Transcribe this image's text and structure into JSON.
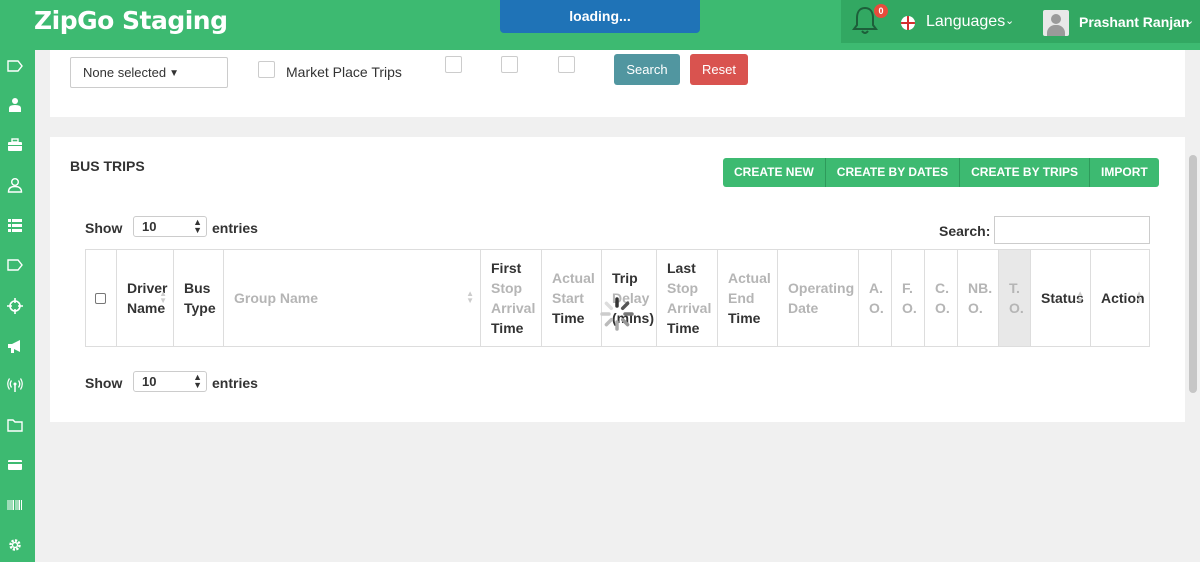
{
  "header": {
    "brand": "ZipGo Staging",
    "loading_text": "loading...",
    "notifications_count": "0",
    "languages_label": "Languages",
    "user_name": "Prashant Ranjan",
    "icons": [
      "bell-icon",
      "england-flag-icon",
      "chevron-down-icon",
      "user-avatar",
      "chevron-down-icon"
    ]
  },
  "sidebar": {
    "icons": [
      "tag-icon",
      "driver-icon",
      "briefcase-icon",
      "user-icon",
      "list-icon",
      "tag-icon",
      "crosshair-icon",
      "megaphone-icon",
      "antenna-icon",
      "folder-icon",
      "credit-card-icon",
      "barcode-icon",
      "gear-icon"
    ]
  },
  "filters": {
    "multiselect_value": "None selected",
    "market_place_label": "Market Place Trips",
    "search_button": "Search",
    "reset_button": "Reset"
  },
  "bus_trips": {
    "title": "BUS TRIPS",
    "actions": [
      "CREATE NEW",
      "CREATE BY DATES",
      "CREATE BY TRIPS",
      "IMPORT"
    ],
    "show_label": "Show",
    "entries_value": "10",
    "entries_label": "entries",
    "search_label": "Search:",
    "search_value": "",
    "columns": [
      {
        "line1": "",
        "line2": "",
        "line3": "",
        "line4": ""
      },
      {
        "line1": "Driver",
        "line2": "Name",
        "line3": "",
        "line4": ""
      },
      {
        "line1": "Bus",
        "line2": "Type",
        "line3": "",
        "line4": ""
      },
      {
        "line1": "Group Name",
        "line2": "",
        "line3": "",
        "line4": ""
      },
      {
        "line1": "First",
        "line2": "Stop",
        "line3": "Arrival",
        "line4": "Time"
      },
      {
        "line1": "Actual",
        "line2": "Start",
        "line3": "Time",
        "line4": ""
      },
      {
        "line1": "Trip",
        "line2": "Delay",
        "line3": "(mins)",
        "line4": ""
      },
      {
        "line1": "Last",
        "line2": "Stop",
        "line3": "Arrival",
        "line4": "Time"
      },
      {
        "line1": "Actual",
        "line2": "End",
        "line3": "Time",
        "line4": ""
      },
      {
        "line1": "Operating",
        "line2": "Date",
        "line3": "",
        "line4": ""
      },
      {
        "line1": "A.",
        "line2": "O.",
        "line3": "",
        "line4": ""
      },
      {
        "line1": "F.",
        "line2": "O.",
        "line3": "",
        "line4": ""
      },
      {
        "line1": "C.",
        "line2": "O.",
        "line3": "",
        "line4": ""
      },
      {
        "line1": "NB.",
        "line2": "O.",
        "line3": "",
        "line4": ""
      },
      {
        "line1": "T.",
        "line2": "O.",
        "line3": "",
        "line4": ""
      },
      {
        "line1": "Status",
        "line2": "",
        "line3": "",
        "line4": ""
      },
      {
        "line1": "Action",
        "line2": "",
        "line3": "",
        "line4": ""
      }
    ],
    "rows": []
  },
  "colors": {
    "brand_green": "#3dba71",
    "loading_blue": "#1f73b7",
    "search_teal": "#5196a0",
    "reset_red": "#d9534f"
  }
}
